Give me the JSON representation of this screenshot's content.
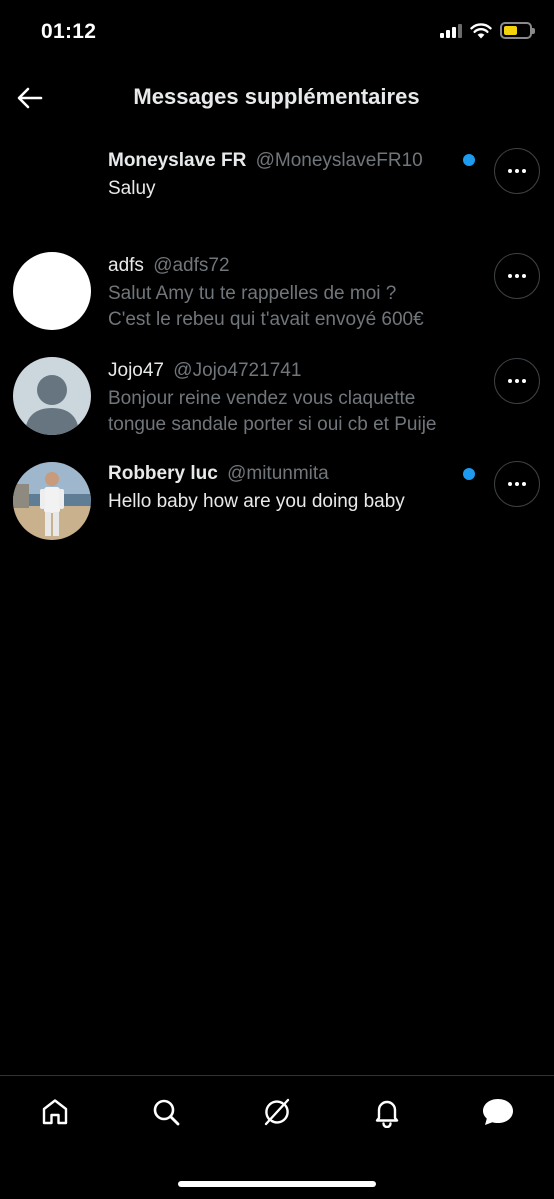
{
  "status_bar": {
    "time": "01:12"
  },
  "header": {
    "title": "Messages supplémentaires"
  },
  "conversations": [
    {
      "name": "Moneyslave FR",
      "handle": "@MoneyslaveFR10",
      "preview": "Saluy",
      "unread": true,
      "avatar": "none"
    },
    {
      "name": "adfs",
      "handle": "@adfs72",
      "preview_line1": "Salut Amy tu te rappelles de moi ?",
      "preview_line2": "C'est le rebeu qui t'avait envoyé 600€",
      "unread": false,
      "avatar": "white-circle"
    },
    {
      "name": "Jojo47",
      "handle": "@Jojo4721741",
      "preview_line1": "Bonjour reine vendez vous claquette",
      "preview_line2": "tongue sandale porter si oui cb et Puije",
      "unread": false,
      "avatar": "default-person-icon"
    },
    {
      "name": "Robbery luc",
      "handle": "@mitunmita",
      "preview": "Hello baby how are you doing baby",
      "unread": true,
      "avatar": "photo"
    }
  ],
  "bottom_nav": {
    "items": [
      "home-icon",
      "search-icon",
      "grok-icon",
      "notifications-bell-icon",
      "messages-icon"
    ]
  },
  "colors": {
    "accent": "#1d9bf0",
    "background": "#000000",
    "text": "#e7e9ea",
    "secondary": "#71767b"
  }
}
